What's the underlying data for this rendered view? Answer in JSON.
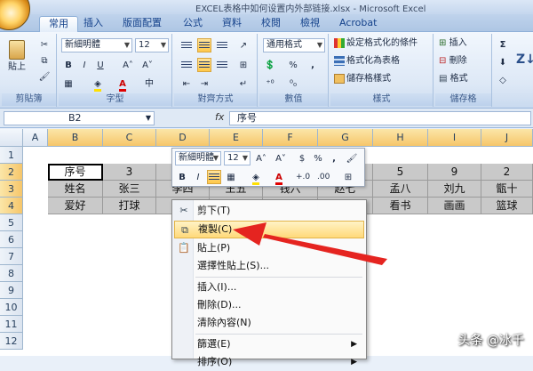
{
  "window": {
    "title": "EXCEL表格中如何设置内外部链接.xlsx - Microsoft Excel"
  },
  "tabs": [
    "常用",
    "插入",
    "版面配置",
    "公式",
    "資料",
    "校閱",
    "檢視",
    "Acrobat"
  ],
  "ribbon": {
    "clipboard": {
      "label": "剪貼簿",
      "paste": "貼上"
    },
    "font": {
      "label": "字型",
      "name": "新細明體",
      "size": "12",
      "bold": "B",
      "italic": "I",
      "underline": "U",
      "grow": "A˄",
      "shrink": "A˅",
      "color_letter": "A"
    },
    "align": {
      "label": "對齊方式"
    },
    "number": {
      "label": "數值",
      "format": "通用格式",
      "percent": "%",
      "comma": ","
    },
    "styles": {
      "label": "樣式",
      "conditional": "設定格式化的條件",
      "as_table": "格式化為表格",
      "cell_styles": "儲存格樣式"
    },
    "cells": {
      "label": "儲存格",
      "insert": "插入",
      "delete": "刪除",
      "format": "格式"
    },
    "editing": {
      "sigma": "Σ"
    }
  },
  "formula": {
    "cell_ref": "B2",
    "fx": "fx",
    "content": "序号"
  },
  "columns": [
    "A",
    "B",
    "C",
    "D",
    "E",
    "F",
    "G",
    "H",
    "I",
    "J"
  ],
  "rows": [
    "1",
    "2",
    "3",
    "4",
    "5",
    "6",
    "7",
    "8",
    "9",
    "10",
    "11",
    "12"
  ],
  "table": {
    "row2": [
      "序号",
      "3",
      "",
      "",
      "",
      "",
      "5",
      "9",
      "2"
    ],
    "row3": [
      "姓名",
      "张三",
      "李四",
      "王五",
      "钱六",
      "赵七",
      "孟八",
      "刘九",
      "甑十"
    ],
    "row4": [
      "爱好",
      "打球",
      "",
      "",
      "",
      "",
      "看书",
      "画画",
      "篮球"
    ]
  },
  "minibar": {
    "font": "新細明體",
    "size": "12",
    "grow": "A˄",
    "shrink": "A˅",
    "currency": "$",
    "percent": "%",
    "comma": ",",
    "bold": "B",
    "italic": "I",
    "color_letter": "A",
    "inc_dec": "+.0",
    "dec_dec": ".00"
  },
  "context_menu": {
    "cut": "剪下(T)",
    "copy": "複製(C)",
    "paste": "貼上(P)",
    "paste_special": "選擇性貼上(S)...",
    "insert": "插入(I)...",
    "delete": "刪除(D)...",
    "clear": "清除內容(N)",
    "filter": "篩選(E)",
    "sort": "排序(O)"
  },
  "watermark": "头条 @冰千"
}
